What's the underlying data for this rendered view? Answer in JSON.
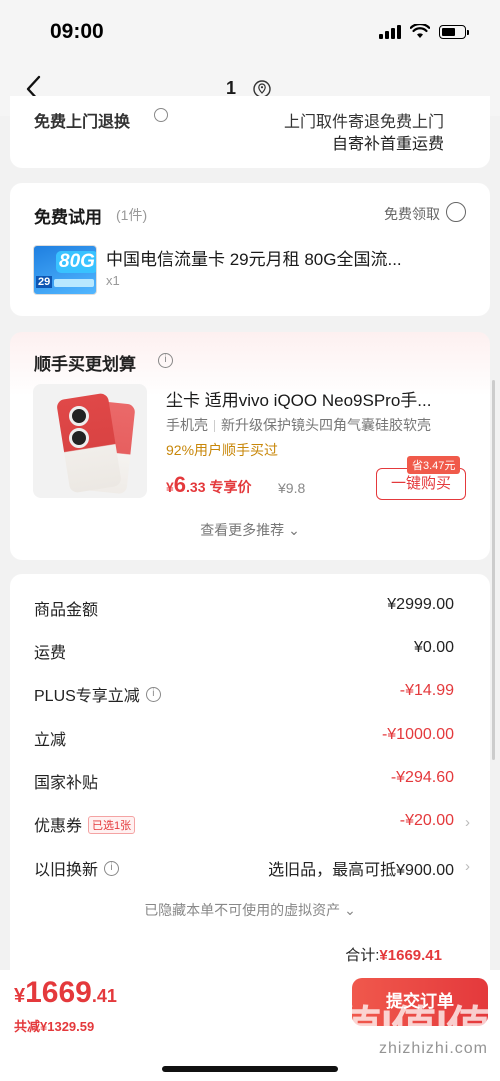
{
  "status_bar": {
    "time": "09:00"
  },
  "nav": {
    "title": "1"
  },
  "delivery": {
    "left": "免费上门退换",
    "right_1": "上门取件寄退免费上门",
    "right_2": "自寄补首重运费"
  },
  "trial": {
    "title": "免费试用",
    "count": "(1件)",
    "claim": "免费领取",
    "item_name": "中国电信流量卡 29元月租 80G全国流...",
    "item_qty": "x1",
    "thumb_big": "80G",
    "thumb_price": "29"
  },
  "reco": {
    "title": "顺手买更划算",
    "item_name": "尘卡 适用vivo iQOO Neo9SPro手...",
    "sub_1": "手机壳",
    "sub_2": "新升级保护镜头四角气囊硅胶软壳",
    "buy_pct": "92%用户顺手买过",
    "price_sym": "¥",
    "price_int": "6",
    "price_dec": ".33",
    "price_tag": "专享价",
    "orig_price": "¥9.8",
    "save_badge": "省3.47元",
    "buy_btn": "一键购买",
    "more": "查看更多推荐"
  },
  "price_details": {
    "rows": [
      {
        "label": "商品金额",
        "value": "¥2999.00"
      },
      {
        "label": "运费",
        "value": "¥0.00"
      },
      {
        "label": "PLUS专享立减",
        "value": "-¥14.99"
      },
      {
        "label": "立减",
        "value": "-¥1000.00"
      },
      {
        "label": "国家补贴",
        "value": "-¥294.60"
      },
      {
        "label": "优惠券",
        "badge": "已选1张",
        "value": "-¥20.00"
      },
      {
        "label": "以旧换新",
        "value": "选旧品，最高可抵¥900.00"
      }
    ],
    "hidden_note": "已隐藏本单不可使用的虚拟资产",
    "total_label": "合计:",
    "total_value": "¥1669.41"
  },
  "bottom": {
    "pay_sym": "¥",
    "pay_int": "1669",
    "pay_dec": ".41",
    "saved": "共减¥1329.59",
    "pay_btn": "提交订单",
    "watermark": "值|值|值",
    "watermark_url": "zhizhizhi.com"
  },
  "colors": {
    "accent": "#e4393c",
    "gold": "#c8870a"
  }
}
